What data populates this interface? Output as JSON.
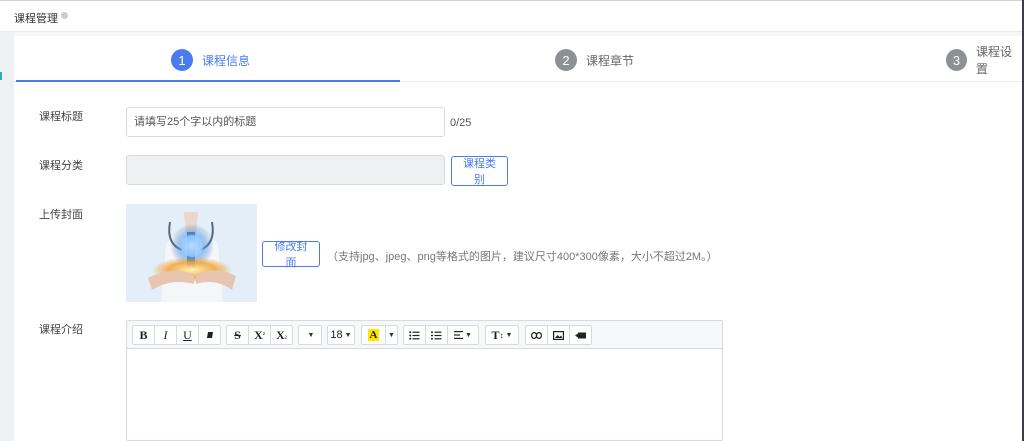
{
  "tab": {
    "title": "课程管理"
  },
  "steps": [
    {
      "num": "1",
      "label": "课程信息",
      "state": "active"
    },
    {
      "num": "2",
      "label": "课程章节",
      "state": "inactive"
    },
    {
      "num": "3",
      "label": "课程设置",
      "state": "inactive"
    }
  ],
  "form": {
    "title_label": "课程标题",
    "title_placeholder": "请填写25个字以内的标题",
    "title_count": "0/25",
    "category_label": "课程分类",
    "category_button": "课程类别",
    "cover_label": "上传封面",
    "cover_button": "修改封面",
    "cover_hint": "（支持jpg、jpeg、png等格式的图片，建议尺寸400*300像素，大小不超过2M。）",
    "intro_label": "课程介绍"
  },
  "toolbar": {
    "bold": "B",
    "italic": "I",
    "underline": "U",
    "strike": "S",
    "superscript": "X",
    "superscript_mark": "²",
    "subscript": "X",
    "subscript_mark": "₂",
    "font_size": "18",
    "color_letter": "A",
    "title_letter": "T"
  },
  "colors": {
    "accent": "#4a7cf0",
    "inactive_step": "#8d9095",
    "highlight": "#ffe600"
  },
  "icons": [
    "eraser-icon",
    "dropdown-caret-icon",
    "bullet-list-icon",
    "numbered-list-icon",
    "align-icon",
    "link-icon",
    "image-icon",
    "video-icon",
    "cover-image-doctor"
  ]
}
